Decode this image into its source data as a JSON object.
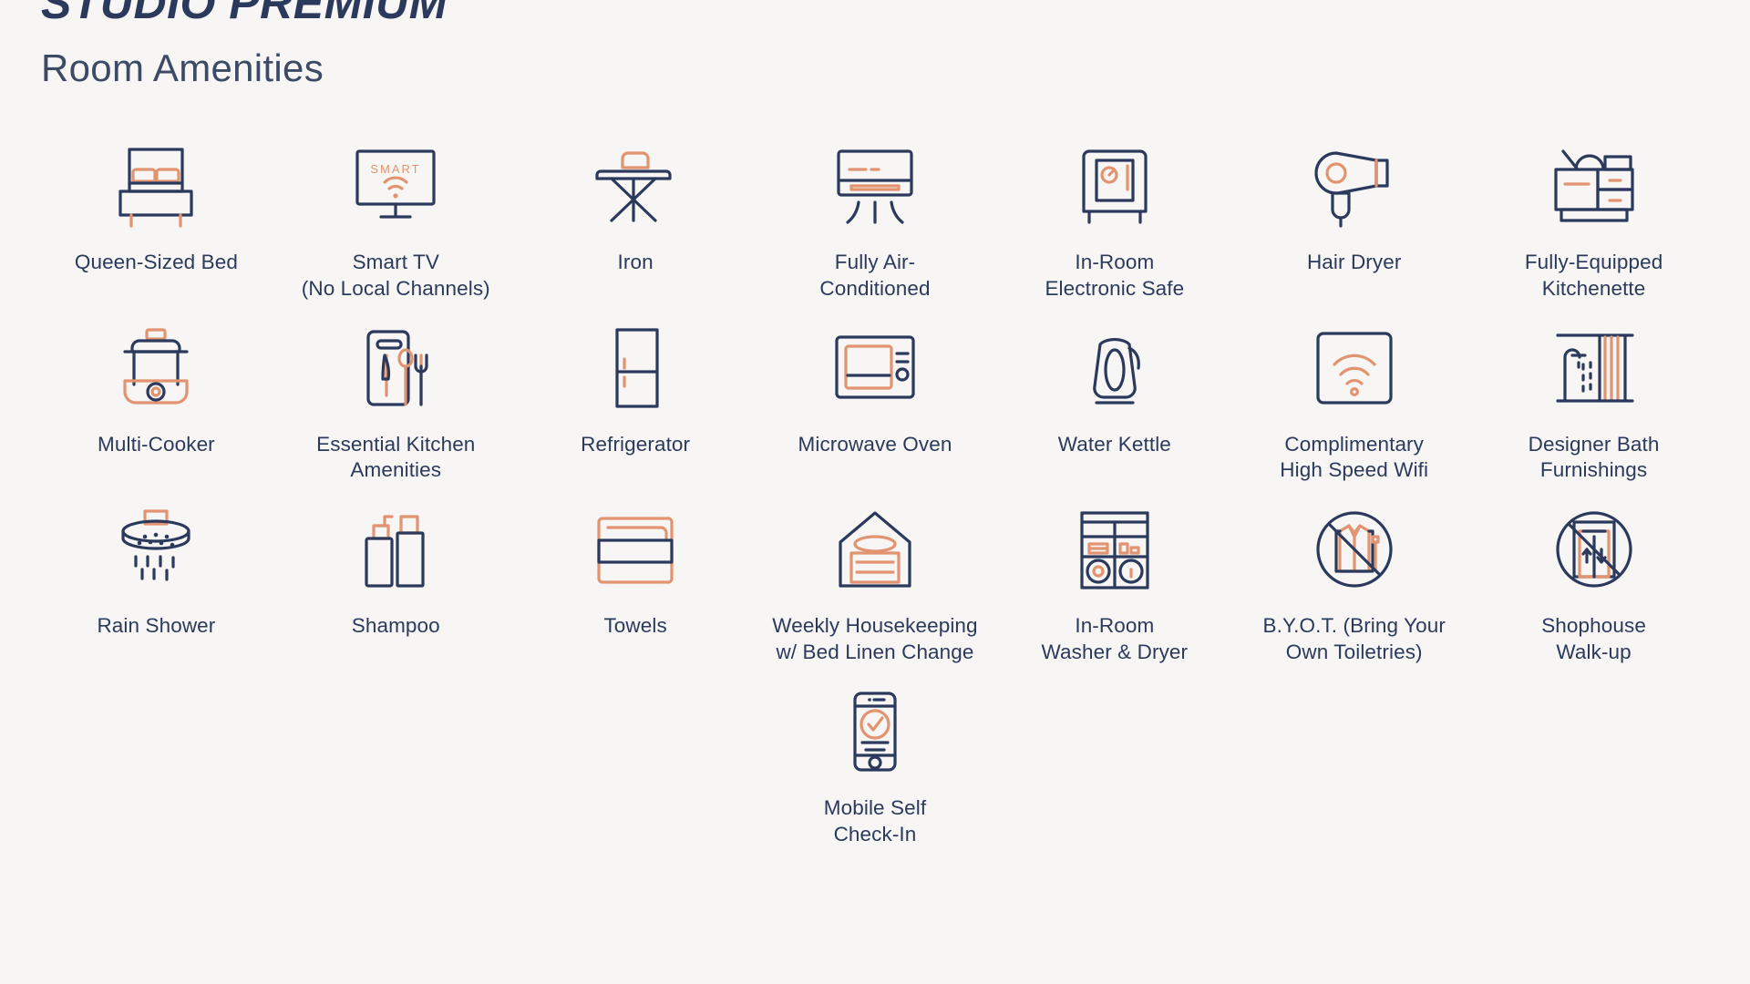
{
  "header": {
    "title": "STUDIO PREMIUM",
    "subtitle": "Room Amenities"
  },
  "colors": {
    "background": "#f7f6f4",
    "navy": "#2b3a5c",
    "orange": "#e29470",
    "text": "#2b3a5c"
  },
  "grid": {
    "columns": 7,
    "items": [
      {
        "icon": "bed-icon",
        "label": "Queen-Sized Bed"
      },
      {
        "icon": "smart-tv-icon",
        "label": "Smart TV\n(No Local Channels)"
      },
      {
        "icon": "iron-icon",
        "label": "Iron"
      },
      {
        "icon": "air-conditioner-icon",
        "label": "Fully Air-\nConditioned"
      },
      {
        "icon": "safe-icon",
        "label": "In-Room\nElectronic Safe"
      },
      {
        "icon": "hair-dryer-icon",
        "label": "Hair Dryer"
      },
      {
        "icon": "kitchenette-icon",
        "label": "Fully-Equipped\nKitchenette"
      },
      {
        "icon": "multi-cooker-icon",
        "label": "Multi-Cooker"
      },
      {
        "icon": "cutlery-board-icon",
        "label": "Essential Kitchen\nAmenities"
      },
      {
        "icon": "refrigerator-icon",
        "label": "Refrigerator"
      },
      {
        "icon": "microwave-icon",
        "label": "Microwave Oven"
      },
      {
        "icon": "kettle-icon",
        "label": "Water Kettle"
      },
      {
        "icon": "wifi-icon",
        "label": "Complimentary\nHigh Speed Wifi"
      },
      {
        "icon": "shower-curtain-icon",
        "label": "Designer Bath\nFurnishings"
      },
      {
        "icon": "rain-shower-icon",
        "label": "Rain Shower"
      },
      {
        "icon": "shampoo-bottles-icon",
        "label": "Shampoo"
      },
      {
        "icon": "towels-icon",
        "label": "Towels"
      },
      {
        "icon": "housekeeping-icon",
        "label": "Weekly Housekeeping\nw/ Bed Linen Change"
      },
      {
        "icon": "washer-dryer-icon",
        "label": "In-Room\nWasher & Dryer"
      },
      {
        "icon": "no-toiletries-icon",
        "label": "B.Y.O.T. (Bring Your\nOwn Toiletries)"
      },
      {
        "icon": "no-elevator-icon",
        "label": "Shophouse\nWalk-up"
      },
      {
        "icon": "mobile-checkin-icon",
        "label": "Mobile Self\nCheck-In"
      }
    ]
  },
  "icon_text": {
    "smart_tv_screen_label": "SMART"
  }
}
